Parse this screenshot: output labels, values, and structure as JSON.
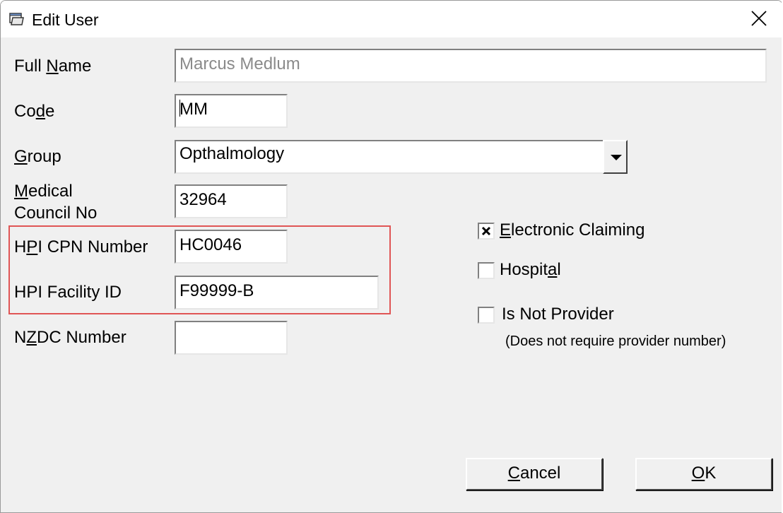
{
  "window": {
    "title": "Edit User",
    "icon": "window-folder-icon",
    "close_icon": "close-icon"
  },
  "form": {
    "full_name": {
      "label_pre": "Full ",
      "label_key": "N",
      "label_post": "ame",
      "value": "Marcus Medlum",
      "disabled": true
    },
    "code": {
      "label_pre": "Co",
      "label_key": "d",
      "label_post": "e",
      "value": "MM"
    },
    "group": {
      "label_pre": "",
      "label_key": "G",
      "label_post": "roup",
      "value": "Opthalmology"
    },
    "medical_council": {
      "label_pre": "",
      "label_key": "M",
      "label_post": "edical",
      "label_line2": "Council No",
      "value": "32964"
    },
    "hpi_cpn": {
      "label_pre": "H",
      "label_key": "P",
      "label_post": "I CPN Number",
      "value": "HC0046"
    },
    "hpi_facility": {
      "label": "HPI Facility ID",
      "value": "F99999-B"
    },
    "nzdc": {
      "label_pre": "N",
      "label_key": "Z",
      "label_post": "DC Number",
      "value": ""
    }
  },
  "options": {
    "electronic_claiming": {
      "label_pre": "",
      "label_key": "E",
      "label_post": "lectronic Claiming",
      "checked": true
    },
    "hospital": {
      "label_pre": "Hospit",
      "label_key": "a",
      "label_post": "l",
      "checked": false
    },
    "is_not_provider": {
      "label": "Is Not Provider",
      "note": "(Does not require provider number)",
      "checked": false
    }
  },
  "buttons": {
    "cancel": {
      "label_key": "C",
      "label_post": "ancel"
    },
    "ok": {
      "label_key": "O",
      "label_post": "K"
    }
  },
  "colors": {
    "highlight_border": "#e05555",
    "dialog_bg": "#f0f0f0"
  }
}
